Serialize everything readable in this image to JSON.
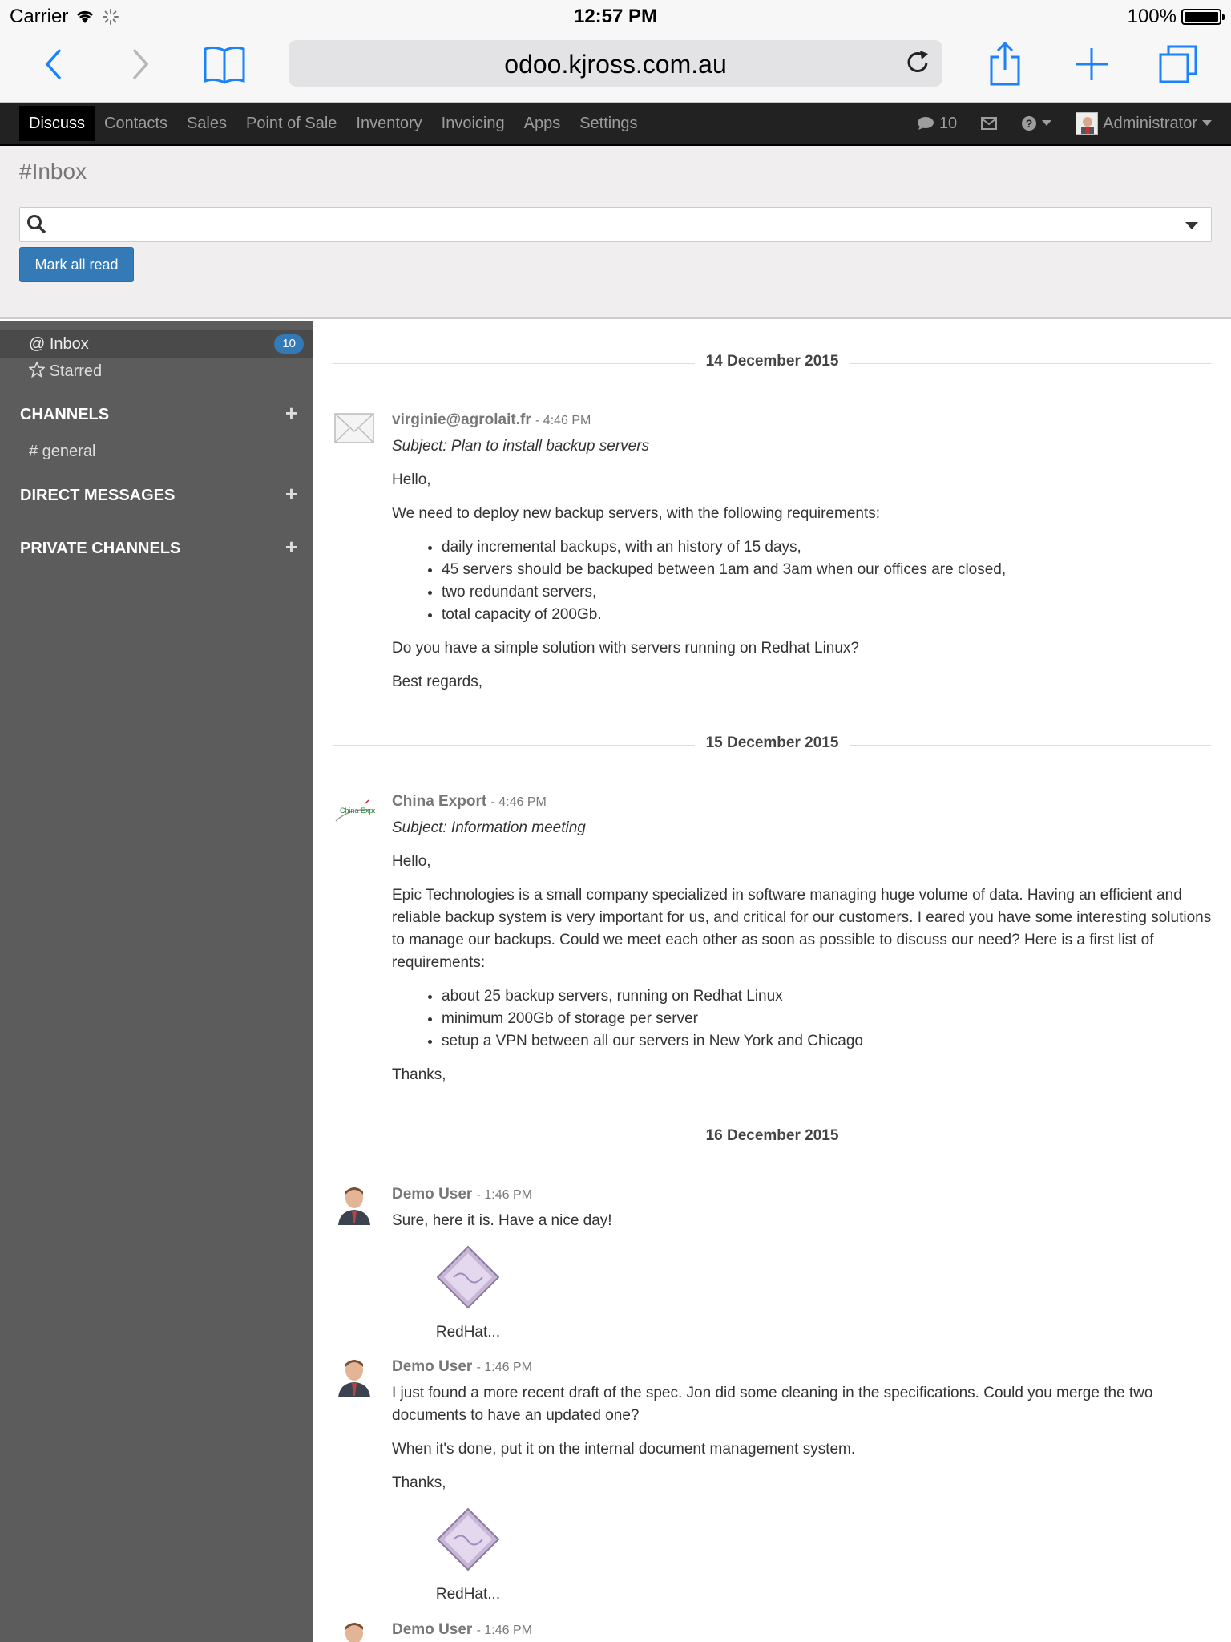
{
  "status_bar": {
    "carrier": "Carrier",
    "time": "12:57 PM",
    "battery": "100%"
  },
  "browser": {
    "url": "odoo.kjross.com.au"
  },
  "navbar": {
    "apps": [
      "Discuss",
      "Contacts",
      "Sales",
      "Point of Sale",
      "Inventory",
      "Invoicing",
      "Apps",
      "Settings"
    ],
    "messages_count": "10",
    "user": "Administrator"
  },
  "control_panel": {
    "title": "#Inbox",
    "search_placeholder": "",
    "mark_all_read": "Mark all read"
  },
  "sidebar": {
    "inbox": {
      "label": "@ Inbox",
      "count": "10"
    },
    "starred": "Starred",
    "channels_header": "CHANNELS",
    "channels": [
      "# general"
    ],
    "direct_messages_header": "DIRECT MESSAGES",
    "private_channels_header": "PRIVATE CHANNELS"
  },
  "thread": {
    "dates": [
      "14 December 2015",
      "15 December 2015",
      "16 December 2015"
    ],
    "messages": [
      {
        "author": "virginie@agrolait.fr",
        "time": "- 4:46 PM",
        "subject": "Subject: Plan to install backup servers",
        "p1": "Hello,",
        "p2": "We need to deploy new backup servers, with the following requirements:",
        "bullets": [
          "daily incremental backups, with an history of 15 days,",
          "45 servers should be backuped between 1am and 3am when our offices are closed,",
          "two redundant servers,",
          "total capacity of 200Gb."
        ],
        "p3": "Do you have a simple solution with servers running on Redhat Linux?",
        "p4": "Best regards,"
      },
      {
        "author": "China Export",
        "time": "- 4:46 PM",
        "subject": "Subject: Information meeting",
        "p1": "Hello,",
        "p2": "Epic Technologies is a small company specialized in software managing huge volume of data. Having an efficient and reliable backup system is very important for us, and critical for our customers. I eared you have some interesting solutions to manage our backups. Could we meet each other as soon as possible to discuss our need? Here is a first list of requirements:",
        "bullets": [
          "about 25 backup servers, running on Redhat Linux",
          "minimum 200Gb of storage per server",
          "setup a VPN between all our servers in New York and Chicago"
        ],
        "p3": "Thanks,",
        "logo_text": "China Export"
      },
      {
        "author": "Demo User",
        "time": "- 1:46 PM",
        "p1": "Sure, here it is. Have a nice day!",
        "attachment": "RedHat..."
      },
      {
        "author": "Demo User",
        "time": "- 1:46 PM",
        "p1": "I just found a more recent draft of the spec. Jon did some cleaning in the specifications. Could you merge the two documents to have an updated one?",
        "p2": "When it's done, put it on the internal document management system.",
        "p3": "Thanks,",
        "attachment": "RedHat..."
      },
      {
        "author": "Demo User",
        "time": "- 1:46 PM"
      }
    ]
  },
  "colors": {
    "navbar": "#222222",
    "sidebar": "#5c5c5c",
    "primary": "#337ab7",
    "ios_blue": "#1a82fb"
  }
}
